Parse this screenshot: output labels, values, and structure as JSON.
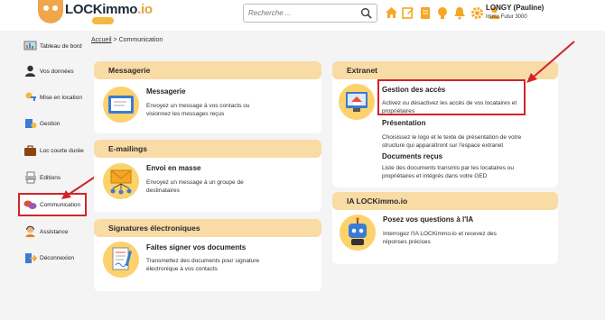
{
  "header": {
    "logo_text": "LOCKimmo",
    "logo_suffix": ".io",
    "search_placeholder": "Recherche ...",
    "user_name": "LONGY (Pauline)",
    "user_org": "Immo Futur 3000",
    "icons": [
      "home-icon",
      "edit-icon",
      "document-icon",
      "bulb-icon",
      "bell-icon",
      "gear-icon",
      "user-icon"
    ]
  },
  "sidebar": {
    "items": [
      {
        "label": "Tableau de bord",
        "icon": "dashboard-icon"
      },
      {
        "label": "Vos données",
        "icon": "person-icon"
      },
      {
        "label": "Mise en location",
        "icon": "key-icon"
      },
      {
        "label": "Gestion",
        "icon": "management-icon"
      },
      {
        "label": "Loc courte durée",
        "icon": "suitcase-icon"
      },
      {
        "label": "Editions",
        "icon": "print-icon"
      },
      {
        "label": "Communication",
        "icon": "chat-icon"
      },
      {
        "label": "Assistance",
        "icon": "support-icon"
      },
      {
        "label": "Déconnexion",
        "icon": "logout-icon"
      }
    ],
    "active": "Communication"
  },
  "breadcrumb": {
    "home": "Accueil",
    "separator": ">",
    "current": "Communication"
  },
  "panels": {
    "messagerie": {
      "title": "Messagerie",
      "card_title": "Messagerie",
      "card_desc": "Envoyez un message à vos contacts ou visionnez les messages reçus"
    },
    "emailings": {
      "title": "E-mailings",
      "card_title": "Envoi en masse",
      "card_desc": "Envoyez un message à un groupe de destinataires"
    },
    "signatures": {
      "title": "Signatures électroniques",
      "card_title": "Faites signer vos documents",
      "card_desc": "Transmettez des documents pour signature électronique à vos contacts"
    },
    "extranet": {
      "title": "Extranet",
      "items": [
        {
          "title": "Gestion des accès",
          "desc": "Activez ou désactivez les accès de vos locataires et propriétaires"
        },
        {
          "title": "Présentation",
          "desc": "Choisissez le logo et le texte de présentation de votre structure qui apparaîtront sur l'espace extranet"
        },
        {
          "title": "Documents reçus",
          "desc": "Liste des documents transmis par les locataires ou propriétaires et intégrés dans votre GED"
        }
      ]
    },
    "ia": {
      "title": "IA LOCKimmo.io",
      "card_title": "Posez vos questions à l'IA",
      "card_desc": "Interrogez l'IA LOCKimmo.io et recevez des réponses précises"
    }
  },
  "colors": {
    "accent": "#f5a623",
    "panel_header": "#f9dba6",
    "highlight": "#d0252b",
    "icon_bg": "#fbd26c"
  }
}
